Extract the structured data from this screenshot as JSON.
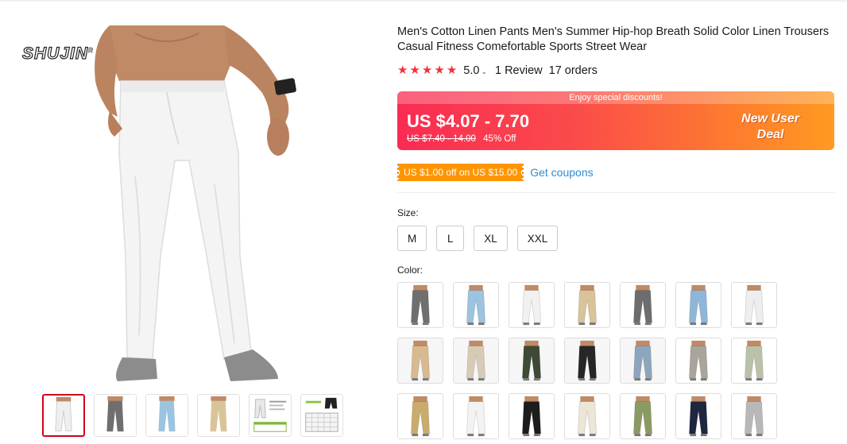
{
  "brand": {
    "logo_text": "SHUJIN",
    "logo_mark": "R"
  },
  "product": {
    "title": "Men's Cotton Linen Pants Men's Summer Hip-hop Breath Solid Color Linen Trousers Casual Fitness Comefortable Sports Street Wear",
    "rating": "5.0",
    "reviews": "1 Review",
    "orders": "17 orders"
  },
  "price": {
    "banner_note": "Enjoy special discounts!",
    "range": "US $4.07 - 7.70",
    "original": "US $7.40 - 14.00",
    "discount": "45% Off",
    "deal_line1": "New User",
    "deal_line2": "Deal"
  },
  "coupon": {
    "tag": "US $1.00 off on US $15.00",
    "link": "Get coupons"
  },
  "size": {
    "label": "Size:",
    "options": [
      "M",
      "L",
      "XL",
      "XXL"
    ]
  },
  "color": {
    "label": "Color:",
    "swatches": [
      "#6f6f6f",
      "#9cc3df",
      "#f1f1ef",
      "#d9c49a",
      "#6d6d6d",
      "#8fb6d8",
      "#eeeeee",
      "#d9b98f",
      "#d8cbb6",
      "#3f4a34",
      "#262626",
      "#8ea6bd",
      "#a9a59a",
      "#b9c2a8",
      "#c9ac6d",
      "#f3f3f3",
      "#1c1c1c",
      "#ece6d6",
      "#8a9a63",
      "#1e2740",
      "#b8b8b8"
    ]
  },
  "colors_theme": {
    "accent_red": "#f0323a",
    "link_blue": "#2e8bd2",
    "coupon_orange": "#ff9500"
  }
}
